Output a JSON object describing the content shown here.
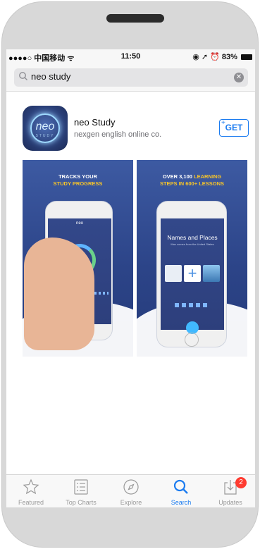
{
  "status_bar": {
    "carrier": "●●●●○ 中国移动 ᯤ",
    "time": "11:50",
    "right": "◉ ➚ ⏰ 83%"
  },
  "search": {
    "query": "neo study",
    "placeholder": ""
  },
  "app": {
    "name": "neo Study",
    "developer": "nexgen english online co.",
    "get_label": "GET",
    "get_plus": "+",
    "icon_word": "neo",
    "icon_sub": "STUDY"
  },
  "screenshots": [
    {
      "caption_line1": "TRACKS YOUR",
      "caption_line2_hl": "STUDY PROGRESS",
      "phone_label": "neo",
      "gauge_label": "A2"
    },
    {
      "caption_line1_a": "OVER 3,100 ",
      "caption_line1_hl": "LEARNING",
      "caption_line2_hl": "STEPS IN 600+ LESSONS",
      "screen_title": "Names and Places",
      "screen_sub": "Max comes from the United States"
    }
  ],
  "tabbar": {
    "items": [
      {
        "label": "Featured",
        "icon": "star-icon"
      },
      {
        "label": "Top Charts",
        "icon": "list-icon"
      },
      {
        "label": "Explore",
        "icon": "compass-icon"
      },
      {
        "label": "Search",
        "icon": "search-icon",
        "active": true
      },
      {
        "label": "Updates",
        "icon": "download-icon",
        "badge": "2"
      }
    ]
  },
  "colors": {
    "accent": "#1a7bf0",
    "badge": "#ff3b30",
    "promo_bg": "#2c4488",
    "promo_highlight": "#f6c42a"
  }
}
